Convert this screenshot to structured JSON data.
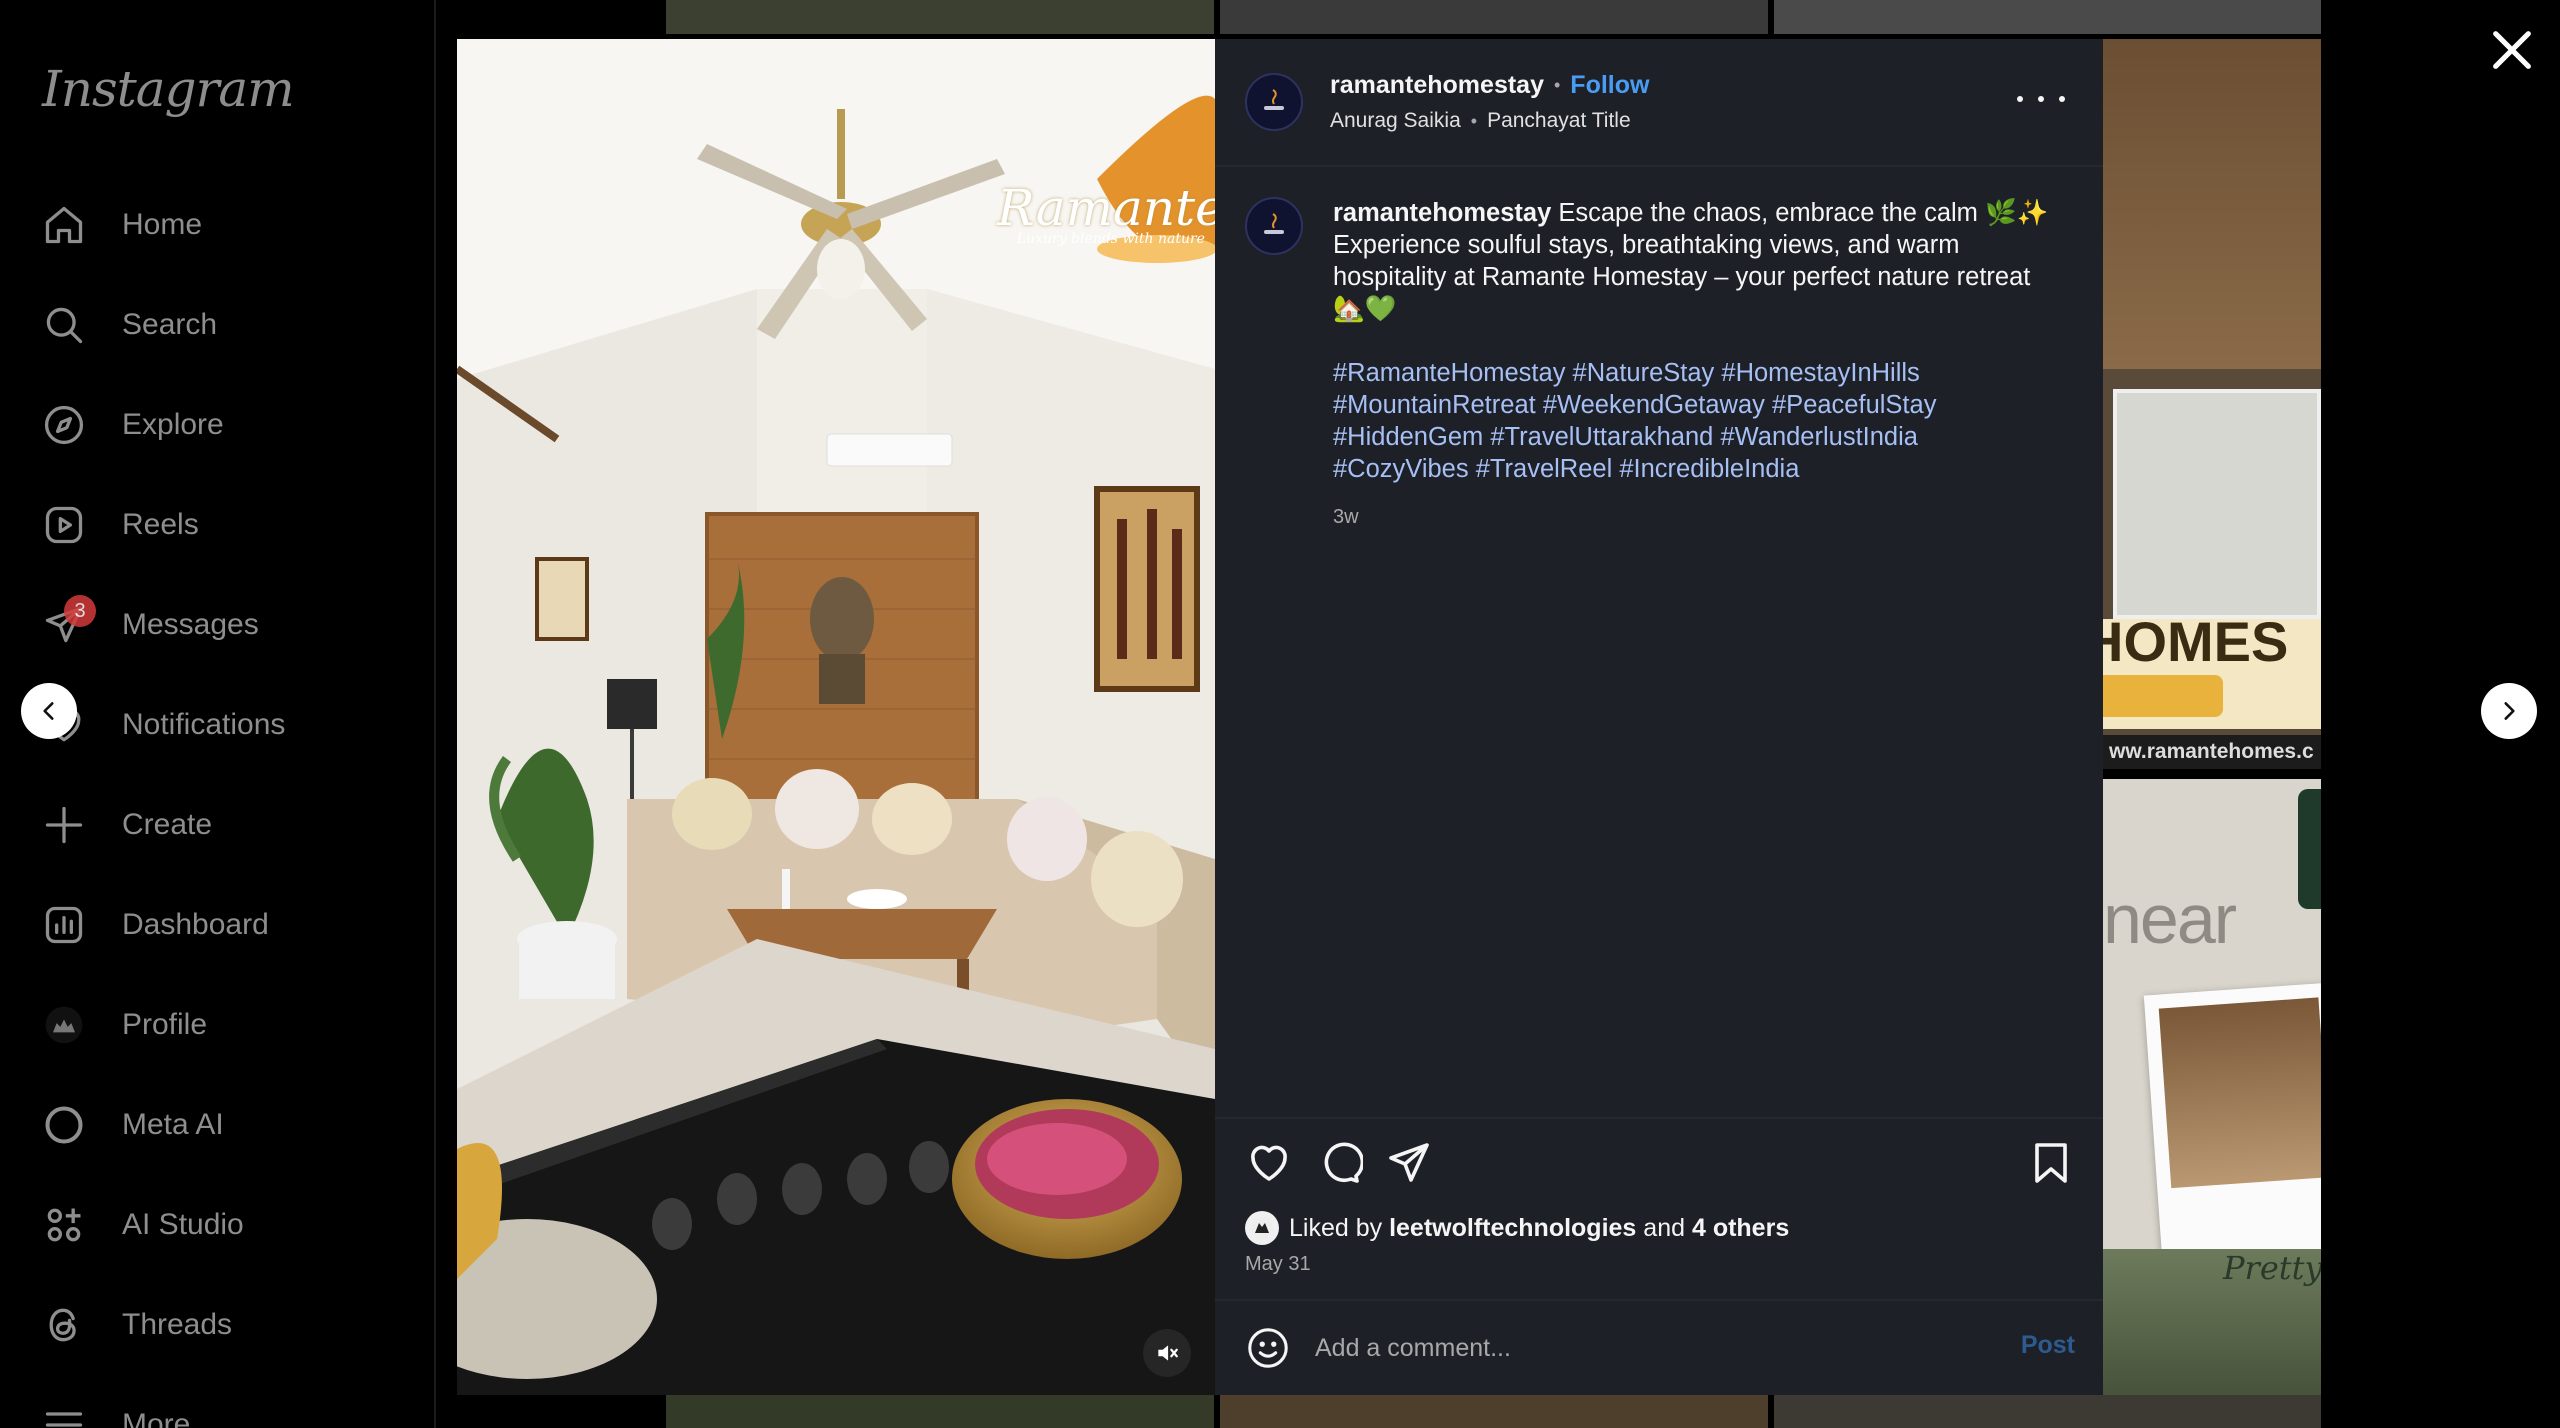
{
  "sidebar": {
    "logo": "Instagram",
    "items": [
      {
        "label": "Home",
        "icon": "home-icon"
      },
      {
        "label": "Search",
        "icon": "search-icon"
      },
      {
        "label": "Explore",
        "icon": "compass-icon"
      },
      {
        "label": "Reels",
        "icon": "reels-icon"
      },
      {
        "label": "Messages",
        "icon": "messenger-icon",
        "badge": "3"
      },
      {
        "label": "Notifications",
        "icon": "heart-icon"
      },
      {
        "label": "Create",
        "icon": "plus-icon"
      },
      {
        "label": "Dashboard",
        "icon": "dashboard-icon"
      },
      {
        "label": "Profile",
        "icon": "profile-avatar-icon"
      },
      {
        "label": "Meta AI",
        "icon": "meta-ai-ring-icon"
      },
      {
        "label": "AI Studio",
        "icon": "ai-studio-icon"
      },
      {
        "label": "Threads",
        "icon": "threads-icon"
      },
      {
        "label": "More",
        "icon": "hamburger-menu-icon"
      }
    ]
  },
  "post": {
    "media_watermark": "Ramante",
    "media_watermark_sub": "Luxury blends with nature",
    "author": "ramantehomestay",
    "follow_label": "Follow",
    "collaborator": "Anurag Saikia",
    "audio": "Panchayat Title",
    "caption_user": "ramantehomestay",
    "caption_text": "Escape the chaos, embrace the calm 🌿✨ Experience soulful stays, breathtaking views, and warm hospitality at Ramante Homestay – your perfect nature retreat 🏡💚",
    "hashtags": [
      "#RamanteHomestay",
      "#NatureStay",
      "#HomestayInHills",
      "#MountainRetreat",
      "#WeekendGetaway",
      "#PeacefulStay",
      "#HiddenGem",
      "#TravelUttarakhand",
      "#WanderlustIndia",
      "#CozyVibes",
      "#TravelReel",
      "#IncredibleIndia"
    ],
    "age": "3w",
    "liked_prefix": "Liked by",
    "liked_user": "leetwolftechnologies",
    "liked_and": "and",
    "liked_others": "4 others",
    "date": "May 31",
    "comment_placeholder": "Add a comment...",
    "post_label": "Post"
  },
  "background": {
    "banner_text": "HOMES",
    "url_text": "ww.ramantehomes.c",
    "near_text": "near",
    "script_text": "Pretty"
  },
  "colors": {
    "panel_bg": "#1e2027",
    "link_blue": "#4a9bf4",
    "hashtag": "#a6bff5",
    "badge_red": "#d43a3a"
  }
}
